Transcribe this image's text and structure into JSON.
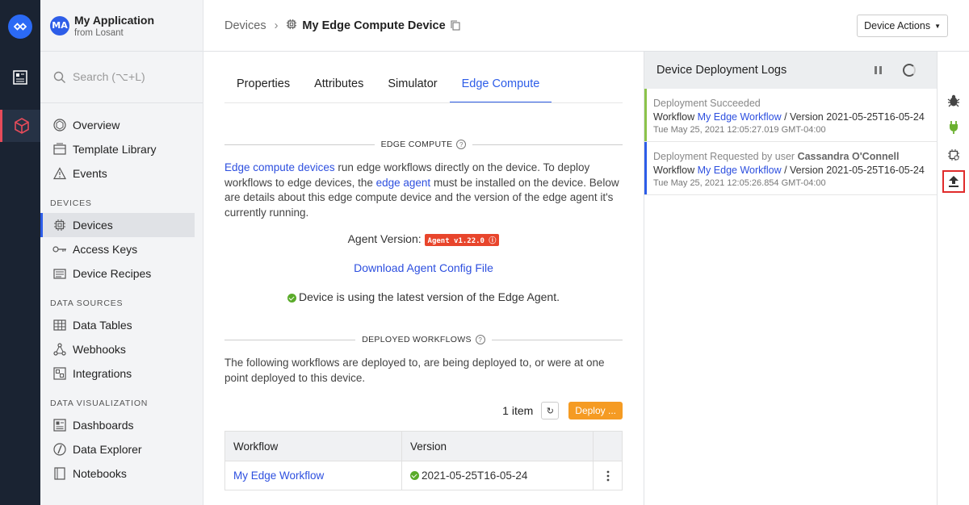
{
  "app": {
    "initials": "MA",
    "name": "My Application",
    "org": "from Losant"
  },
  "search": {
    "placeholder": "Search (⌥+L)"
  },
  "nav": {
    "top": [
      {
        "label": "Overview"
      },
      {
        "label": "Template Library"
      },
      {
        "label": "Events"
      }
    ],
    "devices_header": "DEVICES",
    "devices": [
      {
        "label": "Devices"
      },
      {
        "label": "Access Keys"
      },
      {
        "label": "Device Recipes"
      }
    ],
    "data_sources_header": "DATA SOURCES",
    "data_sources": [
      {
        "label": "Data Tables"
      },
      {
        "label": "Webhooks"
      },
      {
        "label": "Integrations"
      }
    ],
    "data_viz_header": "DATA VISUALIZATION",
    "data_viz": [
      {
        "label": "Dashboards"
      },
      {
        "label": "Data Explorer"
      },
      {
        "label": "Notebooks"
      }
    ]
  },
  "breadcrumb": {
    "parent": "Devices",
    "current": "My Edge Compute Device"
  },
  "device_actions": "Device Actions",
  "tabs": [
    {
      "label": "Properties"
    },
    {
      "label": "Attributes"
    },
    {
      "label": "Simulator"
    },
    {
      "label": "Edge Compute"
    }
  ],
  "edge": {
    "section_title": "EDGE COMPUTE",
    "intro_link1": "Edge compute devices",
    "intro_text1": " run edge workflows directly on the device. To deploy workflows to edge devices, the ",
    "intro_link2": "edge agent",
    "intro_text2": " must be installed on the device. Below are details about this edge compute device and the version of the edge agent it's currently running.",
    "agent_version_label": "Agent Version:",
    "agent_version_badge": "Agent v1.22.0",
    "download_link": "Download Agent Config File",
    "status": "Device is using the latest version of the Edge Agent."
  },
  "deployed": {
    "section_title": "DEPLOYED WORKFLOWS",
    "description": "The following workflows are deployed to, are being deployed to, or were at one point deployed to this device.",
    "count": "1 item",
    "deploy_button": "Deploy ...",
    "columns": [
      "Workflow",
      "Version"
    ],
    "rows": [
      {
        "workflow": "My Edge Workflow",
        "version": "2021-05-25T16-05-24"
      }
    ]
  },
  "logs": {
    "title": "Device Deployment Logs",
    "entries": [
      {
        "status": "Deployment Succeeded",
        "user": "",
        "workflow_prefix": "Workflow ",
        "workflow": "My Edge Workflow",
        "version": " / Version 2021-05-25T16-05-24",
        "time": "Tue May 25, 2021 12:05:27.019 GMT-04:00",
        "color": "#8cc34a"
      },
      {
        "status": "Deployment Requested by user ",
        "user": "Cassandra O'Connell",
        "workflow_prefix": "Workflow ",
        "workflow": "My Edge Workflow",
        "version": " / Version 2021-05-25T16-05-24",
        "time": "Tue May 25, 2021 12:05:26.854 GMT-04:00",
        "color": "#2d5de8"
      }
    ]
  },
  "colors": {
    "accent": "#2d5de8",
    "deploy": "#f59b23",
    "success": "#5aab2a",
    "badge": "#e8452c"
  }
}
